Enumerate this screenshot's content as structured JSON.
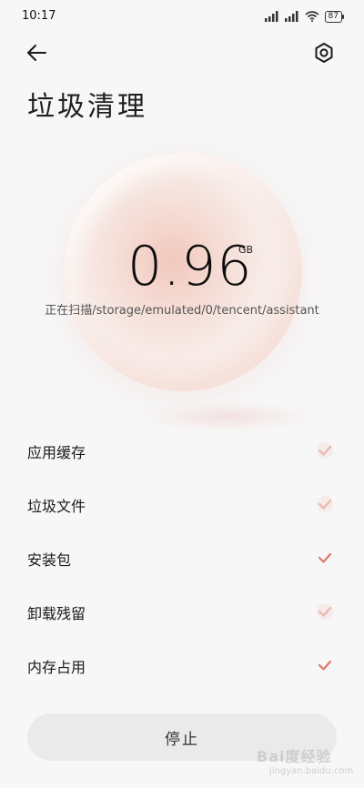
{
  "status_bar": {
    "time": "10:17",
    "battery": "87",
    "icons": [
      "signal-icon",
      "signal-icon",
      "wifi-icon",
      "battery-icon"
    ]
  },
  "header": {
    "back_icon": "arrow-left-icon",
    "settings_icon": "gear-icon",
    "title": "垃圾清理"
  },
  "scan": {
    "size_value": "0.96",
    "size_unit": "GB",
    "path_text": "正在扫描/storage/emulated/0/tencent/assistant"
  },
  "items": [
    {
      "label": "应用缓存",
      "status": "scanning"
    },
    {
      "label": "垃圾文件",
      "status": "scanning"
    },
    {
      "label": "安装包",
      "status": "done"
    },
    {
      "label": "卸载残留",
      "status": "scanning"
    },
    {
      "label": "内存占用",
      "status": "done"
    }
  ],
  "footer": {
    "stop_label": "停止"
  },
  "watermark": {
    "brand": "Bai度经验",
    "url": "jingyan.baidu.com"
  },
  "colors": {
    "accent": "#e0776a",
    "background": "#f7f7f7",
    "button_bg": "#eaeaea"
  }
}
